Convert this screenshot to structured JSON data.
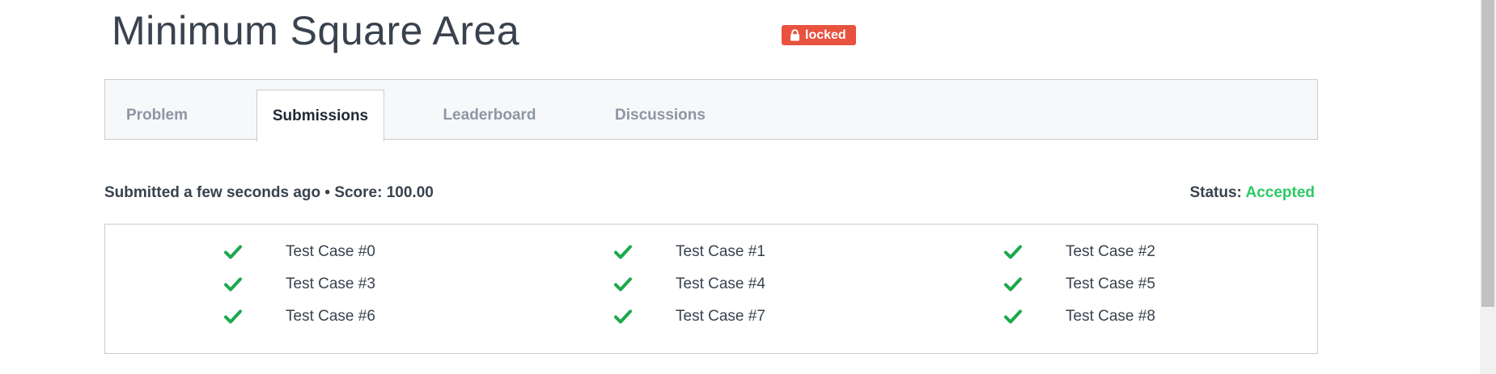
{
  "header": {
    "title": "Minimum Square Area",
    "badge_label": "locked"
  },
  "tabs": [
    {
      "label": "Problem",
      "active": false
    },
    {
      "label": "Submissions",
      "active": true
    },
    {
      "label": "Leaderboard",
      "active": false
    },
    {
      "label": "Discussions",
      "active": false
    }
  ],
  "submission": {
    "summary": "Submitted a few seconds ago • Score: 100.00",
    "status_label": "Status:",
    "status_value": "Accepted"
  },
  "test_cases": [
    {
      "label": "Test Case #0",
      "passed": true
    },
    {
      "label": "Test Case #1",
      "passed": true
    },
    {
      "label": "Test Case #2",
      "passed": true
    },
    {
      "label": "Test Case #3",
      "passed": true
    },
    {
      "label": "Test Case #4",
      "passed": true
    },
    {
      "label": "Test Case #5",
      "passed": true
    },
    {
      "label": "Test Case #6",
      "passed": true
    },
    {
      "label": "Test Case #7",
      "passed": true
    },
    {
      "label": "Test Case #8",
      "passed": true
    }
  ],
  "colors": {
    "badge": "#e8523f",
    "accepted": "#2ec866",
    "check": "#1ba94c",
    "text": "#39424e",
    "tab_inactive": "#8e96a3"
  },
  "icons": {
    "badge_icon": "lock-icon",
    "case_icon": "checkmark-icon"
  }
}
